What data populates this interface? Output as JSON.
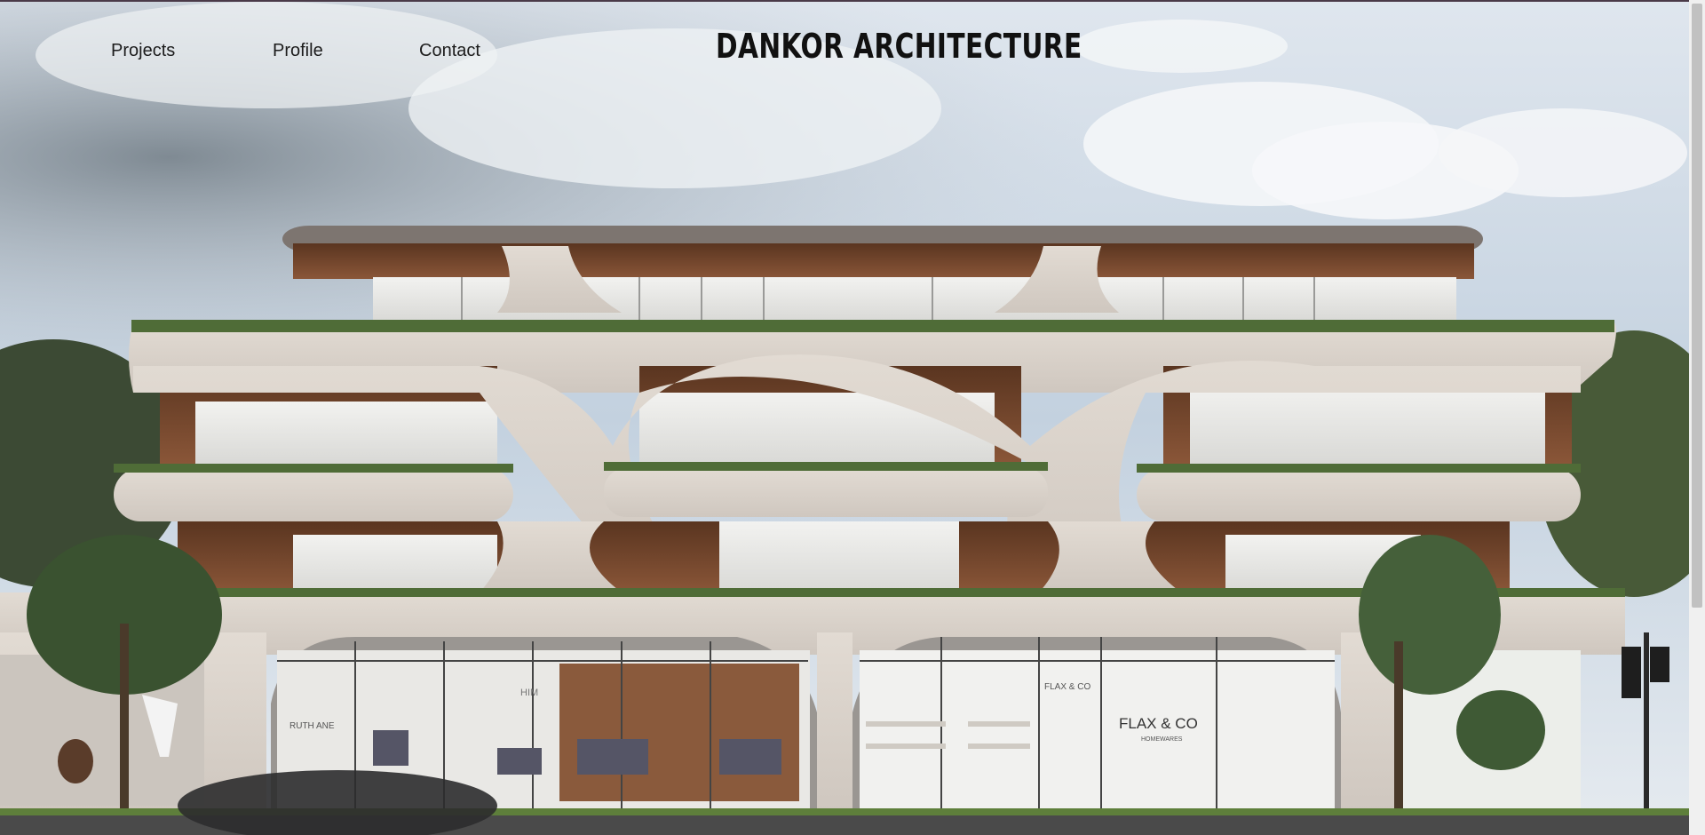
{
  "brand": {
    "name": "DANKOR ARCHITECTURE"
  },
  "nav": {
    "items": [
      {
        "label": "Projects"
      },
      {
        "label": "Profile"
      },
      {
        "label": "Contact"
      }
    ]
  },
  "hero": {
    "store_left_sign": "RUTH ANE",
    "store_mid_sign": "HIM",
    "store_right_sign": "FLAX & CO",
    "store_right_sub": "HOMEWARES",
    "store_right_small": "FLAX & CO"
  },
  "colors": {
    "sky": "#c9d6e2",
    "brick": "#d9d2ca",
    "timber": "#7a4a2e",
    "text": "#1c1c1c"
  }
}
